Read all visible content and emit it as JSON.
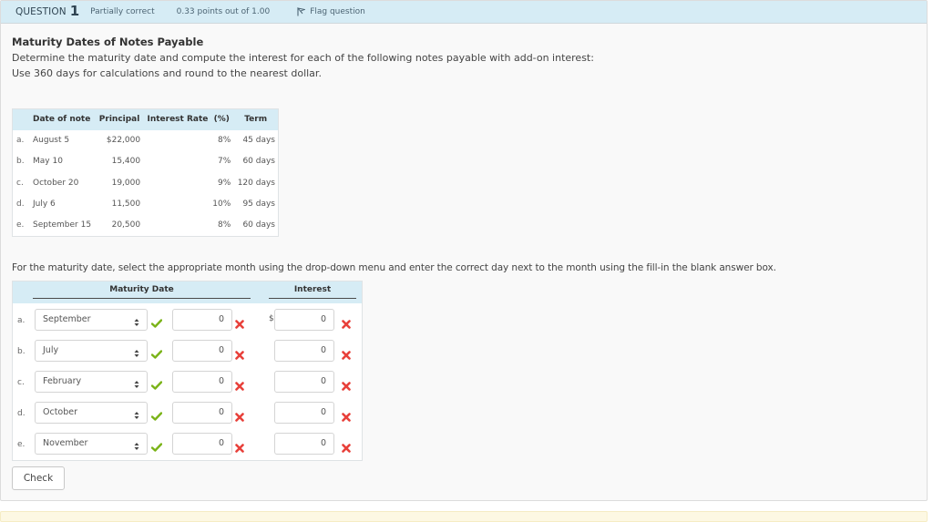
{
  "header": {
    "question_label": "QUESTION",
    "question_number": "1",
    "status": "Partially correct",
    "points": "0.33 points out of 1.00",
    "flag_label": "Flag question"
  },
  "problem": {
    "title": "Maturity Dates of Notes Payable",
    "description": "Determine the maturity date and compute the interest for each of the following notes payable with add-on interest:",
    "note": "Use 360 days for calculations and round to the nearest dollar."
  },
  "given_table": {
    "headers": [
      "Date of note",
      "Principal",
      "Interest Rate",
      "(%)",
      "Term"
    ],
    "rows": [
      {
        "label": "a.",
        "date": "August 5",
        "principal": "$22,000",
        "rate": "8%",
        "term": "45 days"
      },
      {
        "label": "b.",
        "date": "May 10",
        "principal": "15,400",
        "rate": "7%",
        "term": "60 days"
      },
      {
        "label": "c.",
        "date": "October 20",
        "principal": "19,000",
        "rate": "9%",
        "term": "120 days"
      },
      {
        "label": "d.",
        "date": "July 6",
        "principal": "11,500",
        "rate": "10%",
        "term": "95 days"
      },
      {
        "label": "e.",
        "date": "September 15",
        "principal": "20,500",
        "rate": "8%",
        "term": "60 days"
      }
    ]
  },
  "instructions": "For the maturity date, select the appropriate month using the drop-down menu and enter the correct day next to the month using the fill-in the blank answer box.",
  "answer_table": {
    "headers": {
      "maturity_date": "Maturity Date",
      "interest": "Interest"
    },
    "currency_symbol": "$",
    "rows": [
      {
        "label": "a.",
        "month": "September",
        "month_correct": true,
        "day": "0",
        "day_correct": false,
        "interest": "0",
        "interest_correct": false
      },
      {
        "label": "b.",
        "month": "July",
        "month_correct": true,
        "day": "0",
        "day_correct": false,
        "interest": "0",
        "interest_correct": false
      },
      {
        "label": "c.",
        "month": "February",
        "month_correct": true,
        "day": "0",
        "day_correct": false,
        "interest": "0",
        "interest_correct": false
      },
      {
        "label": "d.",
        "month": "October",
        "month_correct": true,
        "day": "0",
        "day_correct": false,
        "interest": "0",
        "interest_correct": false
      },
      {
        "label": "e.",
        "month": "November",
        "month_correct": true,
        "day": "0",
        "day_correct": false,
        "interest": "0",
        "interest_correct": false
      }
    ]
  },
  "check_button": "Check",
  "colors": {
    "header_bg": "#d6ecf5",
    "correct": "#7ab317",
    "incorrect": "#e8403a",
    "footer_bg": "#fdf8e3"
  }
}
